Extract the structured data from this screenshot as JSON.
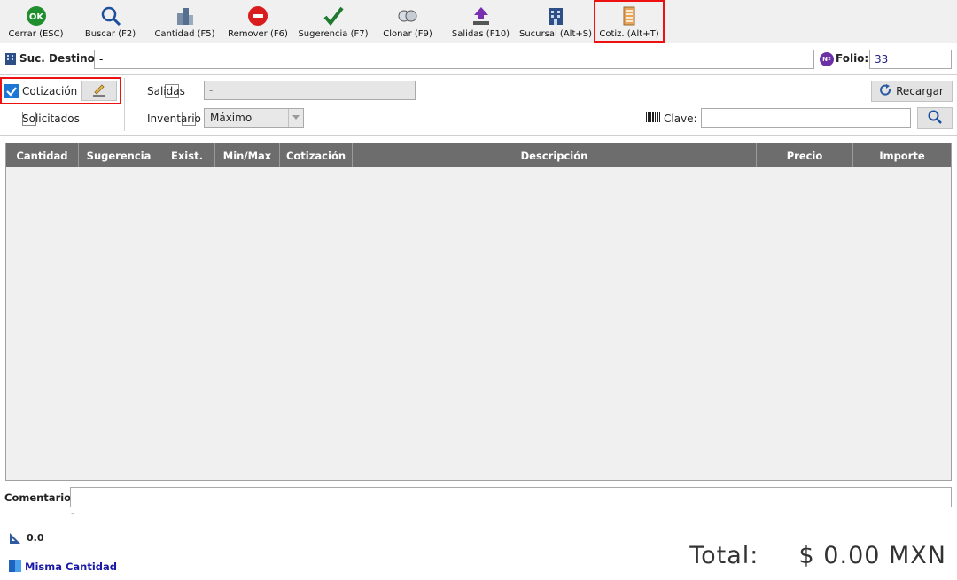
{
  "toolbar": {
    "buttons": [
      {
        "label": "Cerrar (ESC)",
        "icon": "ok-icon",
        "icon_text": "OK"
      },
      {
        "label": "Buscar (F2)",
        "icon": "magnifier-icon"
      },
      {
        "label": "Cantidad (F5)",
        "icon": "buildings-icon"
      },
      {
        "label": "Remover (F6)",
        "icon": "remove-icon"
      },
      {
        "label": "Sugerencia (F7)",
        "icon": "checkmark-icon"
      },
      {
        "label": "Clonar (F9)",
        "icon": "clone-icon"
      },
      {
        "label": "Salidas (F10)",
        "icon": "upload-icon"
      },
      {
        "label": "Sucursal (Alt+S)",
        "icon": "building-icon"
      },
      {
        "label": "Cotiz. (Alt+T)",
        "icon": "document-stack-icon"
      }
    ]
  },
  "destino": {
    "label": "Suc. Destino:",
    "value": "-"
  },
  "folio": {
    "label": "Folio:",
    "badge": "Nº",
    "value": "33"
  },
  "filters": {
    "cotizacion": {
      "label": "Cotización",
      "checked": true
    },
    "solicitados": {
      "label": "Solicitados",
      "checked": false
    },
    "salidas": {
      "label": "Salidas",
      "checked": false,
      "value": "-"
    },
    "inventario": {
      "label": "Inventario",
      "checked": false,
      "selected": "Máximo"
    },
    "recargar": "Recargar",
    "clave": {
      "label": "Clave:",
      "value": ""
    }
  },
  "table": {
    "columns": [
      "Cantidad",
      "Sugerencia",
      "Exist.",
      "Min/Max",
      "Cotización",
      "Descripción",
      "Precio",
      "Importe"
    ],
    "rows": []
  },
  "comentario": {
    "label": "Comentario:",
    "value": "",
    "note": "-"
  },
  "footer": {
    "measure_value": "0.0",
    "misma_cantidad": "Misma Cantidad",
    "total_label": "Total:",
    "total_value": "$ 0.00 MXN"
  },
  "colors": {
    "accent": "#1c78d4",
    "header_bg": "#6d6d6d",
    "highlight": "#e11111",
    "link": "#1a1aa6"
  }
}
